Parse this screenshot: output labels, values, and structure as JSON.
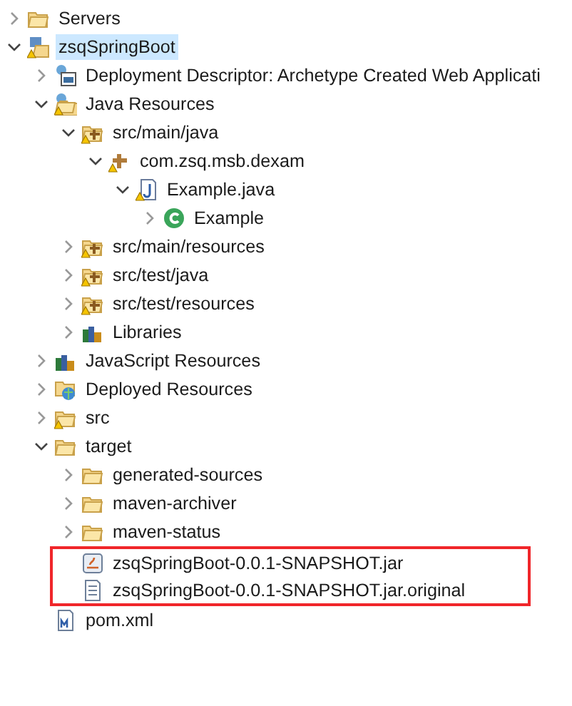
{
  "tree": [
    {
      "label": "Servers",
      "kind": "folder",
      "expanded": false,
      "selected": false
    },
    {
      "label": "zsqSpringBoot",
      "kind": "project",
      "expanded": true,
      "selected": true,
      "children": [
        {
          "label": "Deployment Descriptor: Archetype Created Web Applicati",
          "kind": "descriptor",
          "expanded": false,
          "selected": false
        },
        {
          "label": "Java Resources",
          "kind": "java-resources",
          "expanded": true,
          "selected": false,
          "children": [
            {
              "label": "src/main/java",
              "kind": "source-folder",
              "expanded": true,
              "selected": false,
              "children": [
                {
                  "label": "com.zsq.msb.dexam",
                  "kind": "package",
                  "expanded": true,
                  "selected": false,
                  "children": [
                    {
                      "label": "Example.java",
                      "kind": "java-file",
                      "expanded": true,
                      "selected": false,
                      "children": [
                        {
                          "label": "Example",
                          "kind": "class",
                          "expanded": false,
                          "selected": false
                        }
                      ]
                    }
                  ]
                }
              ]
            },
            {
              "label": "src/main/resources",
              "kind": "source-folder",
              "expanded": false,
              "selected": false
            },
            {
              "label": "src/test/java",
              "kind": "source-folder",
              "expanded": false,
              "selected": false
            },
            {
              "label": "src/test/resources",
              "kind": "source-folder",
              "expanded": false,
              "selected": false
            },
            {
              "label": "Libraries",
              "kind": "libraries",
              "expanded": false,
              "selected": false
            }
          ]
        },
        {
          "label": "JavaScript Resources",
          "kind": "libraries",
          "expanded": false,
          "selected": false
        },
        {
          "label": "Deployed Resources",
          "kind": "deployed",
          "expanded": false,
          "selected": false
        },
        {
          "label": "src",
          "kind": "warn-folder",
          "expanded": false,
          "selected": false
        },
        {
          "label": "target",
          "kind": "folder",
          "expanded": true,
          "selected": false,
          "children": [
            {
              "label": "generated-sources",
              "kind": "folder",
              "expanded": false,
              "selected": false
            },
            {
              "label": "maven-archiver",
              "kind": "folder",
              "expanded": false,
              "selected": false
            },
            {
              "label": "maven-status",
              "kind": "folder",
              "expanded": false,
              "selected": false
            },
            {
              "label": "zsqSpringBoot-0.0.1-SNAPSHOT.jar",
              "kind": "jar",
              "selected": false,
              "highlighted": true
            },
            {
              "label": "zsqSpringBoot-0.0.1-SNAPSHOT.jar.original",
              "kind": "text-file",
              "selected": false,
              "highlighted": true
            }
          ]
        },
        {
          "label": "pom.xml",
          "kind": "pom",
          "selected": false
        }
      ]
    }
  ]
}
